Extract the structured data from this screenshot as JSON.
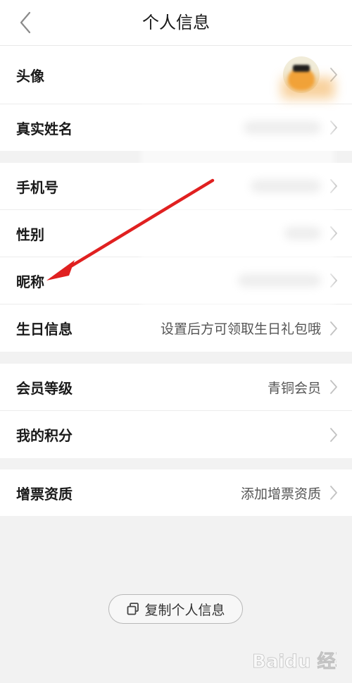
{
  "header": {
    "title": "个人信息",
    "back_icon": "chevron-left-icon"
  },
  "groups": [
    {
      "rows": [
        {
          "label": "头像",
          "value": "",
          "kind": "avatar"
        },
        {
          "label": "真实姓名",
          "value": "",
          "kind": "blurred"
        }
      ]
    },
    {
      "rows": [
        {
          "label": "手机号",
          "value": "",
          "kind": "blurred"
        },
        {
          "label": "性别",
          "value": "",
          "kind": "blurred"
        },
        {
          "label": "昵称",
          "value": "",
          "kind": "blurred"
        },
        {
          "label": "生日信息",
          "value": "设置后方可领取生日礼包哦",
          "kind": "text"
        }
      ]
    },
    {
      "rows": [
        {
          "label": "会员等级",
          "value": "青铜会员",
          "kind": "text"
        },
        {
          "label": "我的积分",
          "value": "",
          "kind": "text"
        }
      ]
    },
    {
      "rows": [
        {
          "label": "增票资质",
          "value": "添加增票资质",
          "kind": "text"
        }
      ]
    }
  ],
  "copy_button": {
    "label": "复制个人信息",
    "icon": "copy-icon"
  },
  "annotation": {
    "color": "#e02020"
  },
  "watermark": {
    "text": "Baidu 经验"
  },
  "colors": {
    "background": "#f2f2f2",
    "row_background": "#ffffff",
    "value_text": "#555555"
  }
}
